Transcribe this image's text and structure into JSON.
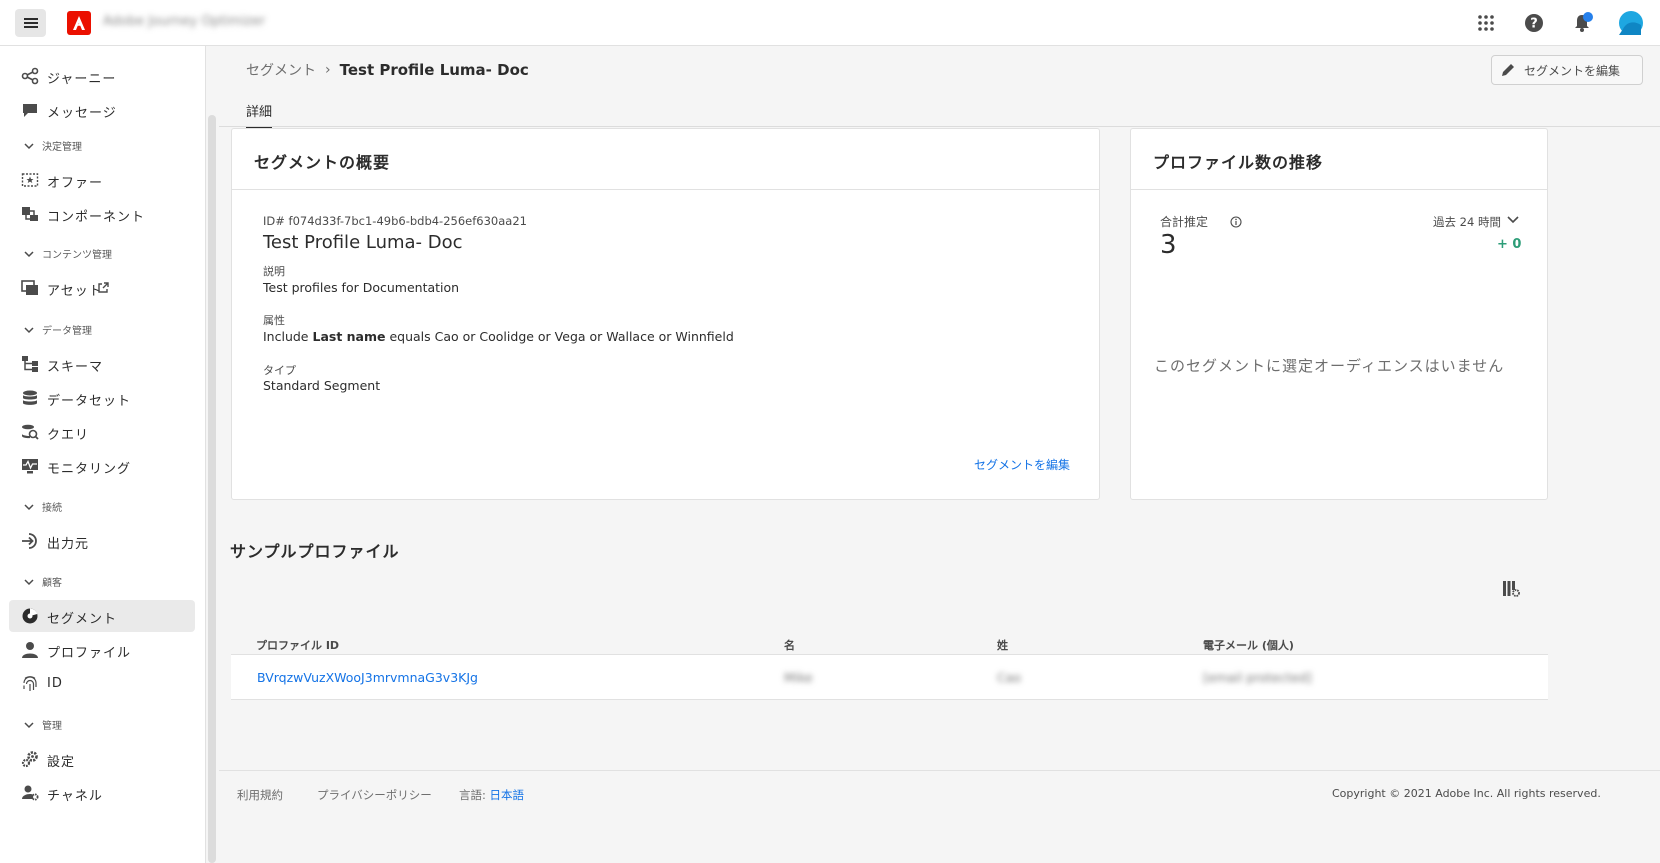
{
  "app": {
    "name": "Adobe Journey Optimizer"
  },
  "sidebar": {
    "items_top": [
      {
        "label": "ジャーニー",
        "icon": "journey-icon"
      },
      {
        "label": "メッセージ",
        "icon": "message-icon"
      }
    ],
    "sections": [
      {
        "label": "決定管理",
        "items": [
          {
            "label": "オファー",
            "icon": "offer-icon"
          },
          {
            "label": "コンポーネント",
            "icon": "component-icon"
          }
        ]
      },
      {
        "label": "コンテンツ管理",
        "items": [
          {
            "label": "アセット",
            "icon": "asset-icon"
          }
        ]
      },
      {
        "label": "データ管理",
        "items": [
          {
            "label": "スキーマ",
            "icon": "schema-icon"
          },
          {
            "label": "データセット",
            "icon": "dataset-icon"
          },
          {
            "label": "クエリ",
            "icon": "query-icon"
          },
          {
            "label": "モニタリング",
            "icon": "monitoring-icon"
          }
        ]
      },
      {
        "label": "接続",
        "items": [
          {
            "label": "出力元",
            "icon": "source-icon"
          }
        ]
      },
      {
        "label": "顧客",
        "items": [
          {
            "label": "セグメント",
            "icon": "segment-icon"
          },
          {
            "label": "プロファイル",
            "icon": "profile-icon"
          },
          {
            "label": "ID",
            "icon": "identity-icon"
          }
        ]
      },
      {
        "label": "管理",
        "items": [
          {
            "label": "設定",
            "icon": "settings-icon"
          },
          {
            "label": "チャネル",
            "icon": "channel-icon"
          }
        ]
      }
    ]
  },
  "breadcrumb": {
    "parent": "セグメント",
    "separator": "›",
    "current": "Test Profile Luma- Doc"
  },
  "header": {
    "edit_button": "セグメントを編集"
  },
  "tabs": [
    {
      "label": "詳細"
    }
  ],
  "overview": {
    "title": "セグメントの概要",
    "id_text": "ID# f074d33f-7bc1-49b6-bdb4-256ef630aa21",
    "name": "Test Profile Luma- Doc",
    "description_label": "説明",
    "description": "Test profiles for Documentation",
    "attributes_label": "属性",
    "attributes_prefix": "Include ",
    "attributes_bold": "Last name",
    "attributes_suffix": " equals Cao or Coolidge or Vega or Wallace or Winnfield",
    "type_label": "タイプ",
    "type": "Standard Segment",
    "edit_link": "セグメントを編集"
  },
  "trend": {
    "title": "プロファイル数の推移",
    "total_label": "合計推定",
    "total_value": "3",
    "period": "過去 24 時間",
    "delta": "+ 0",
    "empty_message": "このセグメントに選定オーディエンスはいません"
  },
  "sample_profiles": {
    "title": "サンプルプロファイル",
    "columns": [
      "プロファイル ID",
      "名",
      "姓",
      "電子メール (個人)"
    ],
    "rows": [
      {
        "id": "BVrqzwVuzXWooJ3mrvmnaG3v3KJg",
        "first": "Mike",
        "last": "Cao",
        "email": "[email protected]"
      }
    ]
  },
  "footer": {
    "terms": "利用規約",
    "privacy": "プライバシーポリシー",
    "language_label": "言語: ",
    "language": "日本語",
    "copyright": "Copyright ©  2021 Adobe Inc.  All rights reserved."
  },
  "colors": {
    "accent": "#1473e6",
    "brand": "#eb1000",
    "delta": "#2d9d78",
    "avatar": "#1ea7e1",
    "notification": "#2680eb"
  }
}
